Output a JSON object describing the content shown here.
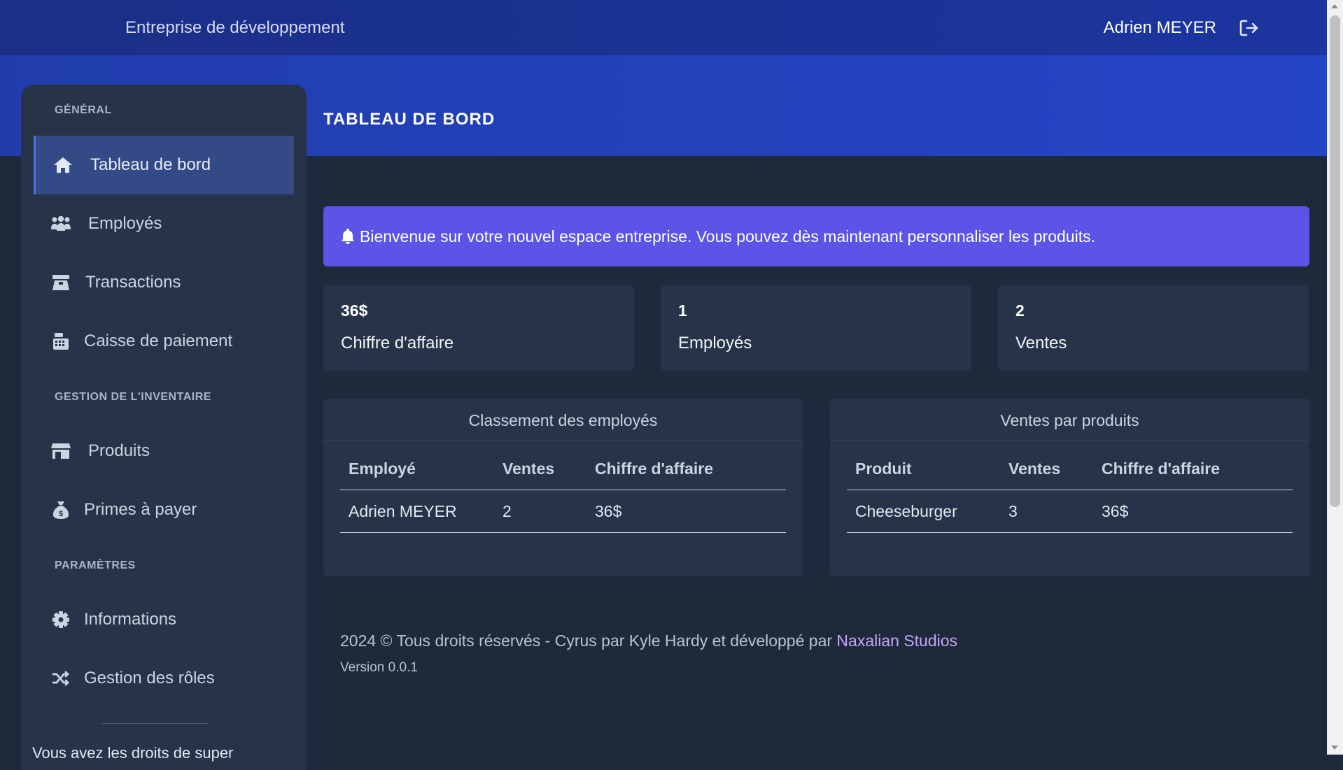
{
  "header": {
    "company": "Entreprise de développement",
    "user": "Adrien MEYER"
  },
  "page": {
    "title": "TABLEAU DE BORD"
  },
  "sidebar": {
    "sections": [
      {
        "label": "GÉNÉRAL"
      },
      {
        "label": "GESTION DE L'INVENTAIRE"
      },
      {
        "label": "PARAMÈTRES"
      }
    ],
    "items": [
      {
        "label": "Tableau de bord",
        "icon": "home-icon",
        "active": true
      },
      {
        "label": "Employés",
        "icon": "users-icon"
      },
      {
        "label": "Transactions",
        "icon": "cash-register-hand-icon"
      },
      {
        "label": "Caisse de paiement",
        "icon": "cash-register-icon"
      },
      {
        "label": "Produits",
        "icon": "store-icon"
      },
      {
        "label": "Primes à payer",
        "icon": "money-bag-icon"
      },
      {
        "label": "Informations",
        "icon": "gear-icon"
      },
      {
        "label": "Gestion des rôles",
        "icon": "shuffle-icon"
      }
    ],
    "note": "Vous avez les droits de super"
  },
  "alert": {
    "text": "Bienvenue sur votre nouvel espace entreprise. Vous pouvez dès maintenant personnaliser les produits."
  },
  "stats": [
    {
      "value": "36$",
      "label": "Chiffre d'affaire"
    },
    {
      "value": "1",
      "label": "Employés"
    },
    {
      "value": "2",
      "label": "Ventes"
    }
  ],
  "employee_ranking": {
    "title": "Classement des employés",
    "headers": [
      "Employé",
      "Ventes",
      "Chiffre d'affaire"
    ],
    "rows": [
      [
        "Adrien MEYER",
        "2",
        "36$"
      ]
    ]
  },
  "product_sales": {
    "title": "Ventes par produits",
    "headers": [
      "Produit",
      "Ventes",
      "Chiffre d'affaire"
    ],
    "rows": [
      [
        "Cheeseburger",
        "3",
        "36$"
      ]
    ]
  },
  "footer": {
    "text": "2024 © Tous droits réservés - Cyrus par Kyle Hardy et développé par",
    "link": "Naxalian Studios",
    "version": "Version 0.0.1"
  },
  "colors": {
    "topbar": "#1a2f86",
    "hero": "#2545c7",
    "background": "#1e293b",
    "card": "#273349",
    "alert": "#5b54e6",
    "active_nav": "#334a86",
    "link": "#c4a6f5"
  }
}
